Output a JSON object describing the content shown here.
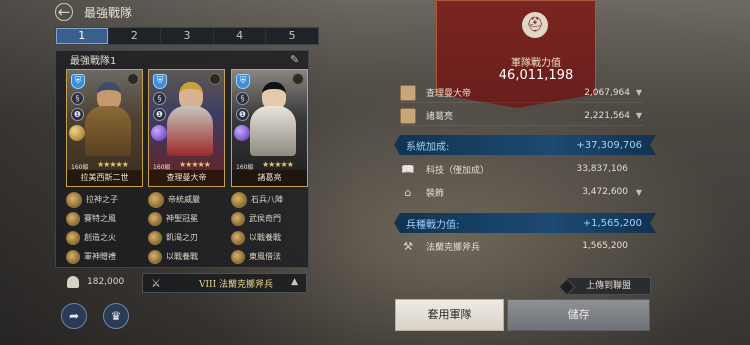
{
  "header": {
    "title": "最強戰隊"
  },
  "tabs": [
    "1",
    "2",
    "3",
    "4",
    "5"
  ],
  "team": {
    "name": "最強戰隊1",
    "power": "182,000",
    "troop_type": "VIII 法蘭克擲斧兵",
    "cards": [
      {
        "name": "拉美西斯二世",
        "level": "160級",
        "stars": "★★★★★",
        "skills": [
          "拉神之子",
          "賽特之風",
          "創造之火",
          "軍神贈禮"
        ]
      },
      {
        "name": "查理曼大帝",
        "level": "160級",
        "stars": "★★★★★",
        "skills": [
          "帝統威嚴",
          "神聖冠冕",
          "飢渴之刃",
          "以戰養戰"
        ]
      },
      {
        "name": "諸葛亮",
        "level": "160級",
        "stars": "★★★★★",
        "skills": [
          "石兵八陣",
          "武侯奇門",
          "以戰養戰",
          "東風借法"
        ]
      }
    ]
  },
  "army_power": {
    "label": "軍隊戰力值",
    "value": "46,011,198"
  },
  "generals": [
    {
      "name": "查理曼大帝",
      "value": "2,067,964"
    },
    {
      "name": "諸葛亮",
      "value": "2,221,564"
    }
  ],
  "system_bonus": {
    "label": "系統加成:",
    "value": "+37,309,706",
    "items": [
      {
        "label": "科技（僅加成）",
        "value": "33,837,106",
        "icon": "book-icon"
      },
      {
        "label": "裝飾",
        "value": "3,472,600",
        "icon": "house-icon"
      }
    ]
  },
  "troop_power": {
    "label": "兵種戰力值:",
    "value": "+1,565,200",
    "items": [
      {
        "label": "法蘭克擲斧兵",
        "value": "1,565,200",
        "icon": "axes-icon"
      }
    ]
  },
  "buttons": {
    "upload": "上傳到聯盟",
    "apply": "套用軍隊",
    "save": "儲存"
  },
  "colors": {
    "accent_blue": "#9fd2ff",
    "tab_active": "#3a5f8d",
    "banner_red": "#7c2522",
    "gold": "#c7a254"
  }
}
